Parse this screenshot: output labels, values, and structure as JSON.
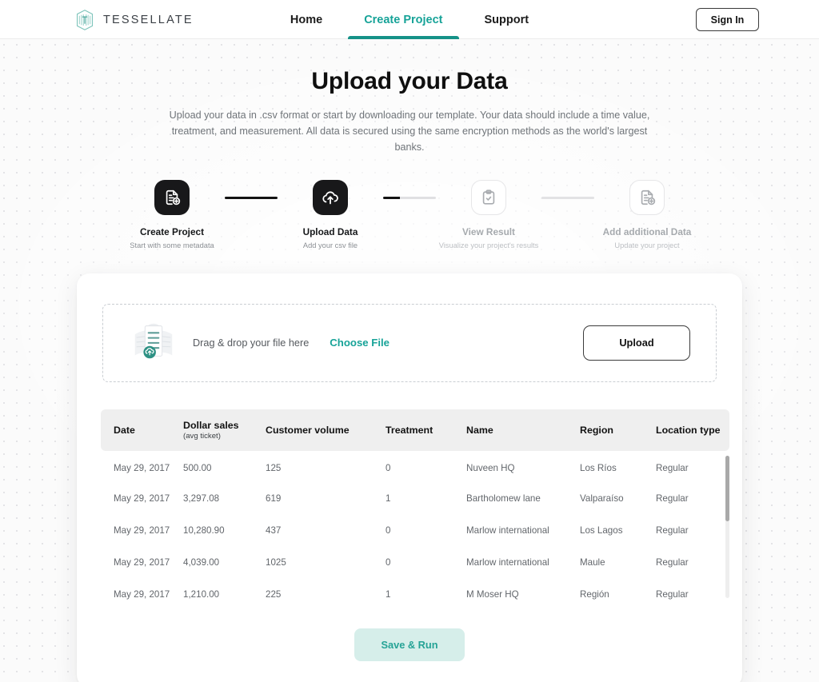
{
  "nav": {
    "brand": "TESSELLATE",
    "brand_logo_icon": "tessellate-hexagon-logo",
    "links": [
      {
        "label": "Home",
        "active": false
      },
      {
        "label": "Create Project",
        "active": true
      },
      {
        "label": "Support",
        "active": false
      }
    ],
    "signin_label": "Sign In",
    "accent_color": "#17a398"
  },
  "hero": {
    "title": "Upload your Data",
    "description": "Upload your data in .csv format or start by downloading our template. Your data should include a time value, treatment, and measurement. All data is secured using the same encryption methods as the world's largest banks."
  },
  "stepper": {
    "steps": [
      {
        "title": "Create Project",
        "subtitle": "Start with some metadata",
        "icon": "document-plus-icon",
        "state": "done"
      },
      {
        "title": "Upload Data",
        "subtitle": "Add your csv file",
        "icon": "cloud-upload-icon",
        "state": "done"
      },
      {
        "title": "View Result",
        "subtitle": "Visualize your project's results",
        "icon": "clipboard-check-icon",
        "state": "todo"
      },
      {
        "title": "Add additional Data",
        "subtitle": "Update your project",
        "icon": "document-plus-icon",
        "state": "todo"
      }
    ]
  },
  "dropzone": {
    "icon": "documents-upload-icon",
    "text": "Drag & drop your file here",
    "choose_file_label": "Choose File",
    "upload_label": "Upload"
  },
  "table": {
    "columns": [
      {
        "label": "Date",
        "sub": ""
      },
      {
        "label": "Dollar sales",
        "sub": "(avg ticket)"
      },
      {
        "label": "Customer volume",
        "sub": ""
      },
      {
        "label": "Treatment",
        "sub": ""
      },
      {
        "label": "Name",
        "sub": ""
      },
      {
        "label": "Region",
        "sub": ""
      },
      {
        "label": "Location type",
        "sub": ""
      }
    ],
    "rows": [
      {
        "date": "May 29, 2017",
        "sales": "500.00",
        "volume": "125",
        "treatment": "0",
        "name": "Nuveen HQ",
        "region": "Los Ríos",
        "location": "Regular"
      },
      {
        "date": "May 29, 2017",
        "sales": "3,297.08",
        "volume": "619",
        "treatment": "1",
        "name": "Bartholomew lane",
        "region": "Valparaíso",
        "location": "Regular"
      },
      {
        "date": "May 29, 2017",
        "sales": "10,280.90",
        "volume": "437",
        "treatment": "0",
        "name": "Marlow international",
        "region": "Los Lagos",
        "location": "Regular"
      },
      {
        "date": "May 29, 2017",
        "sales": "4,039.00",
        "volume": "1025",
        "treatment": "0",
        "name": "Marlow international",
        "region": "Maule",
        "location": "Regular"
      },
      {
        "date": "May 29, 2017",
        "sales": "1,210.00",
        "volume": "225",
        "treatment": "1",
        "name": "M Moser HQ",
        "region": "Región",
        "location": "Regular"
      }
    ]
  },
  "footer": {
    "save_label": "Save & Run"
  }
}
